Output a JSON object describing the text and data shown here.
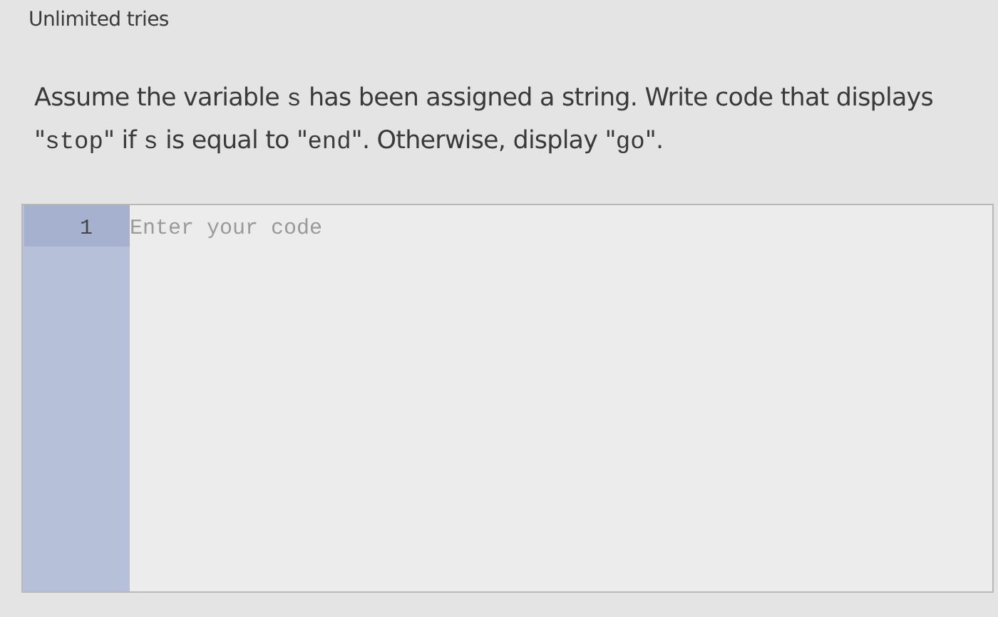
{
  "attempts": {
    "label": "Unlimited tries"
  },
  "prompt": [
    {
      "text": "Assume the variable ",
      "code": false
    },
    {
      "text": "s",
      "code": true
    },
    {
      "text": " has been assigned a string. Write code that displays \"",
      "code": false
    },
    {
      "text": "stop",
      "code": true
    },
    {
      "text": "\" if ",
      "code": false
    },
    {
      "text": "s",
      "code": true
    },
    {
      "text": " is equal to \"",
      "code": false
    },
    {
      "text": "end",
      "code": true
    },
    {
      "text": "\". Otherwise, display \"",
      "code": false
    },
    {
      "text": "go",
      "code": true
    },
    {
      "text": "\".",
      "code": false
    }
  ],
  "editor": {
    "placeholder": "Enter your code",
    "lines": [
      {
        "number": "1",
        "active": true
      }
    ]
  }
}
